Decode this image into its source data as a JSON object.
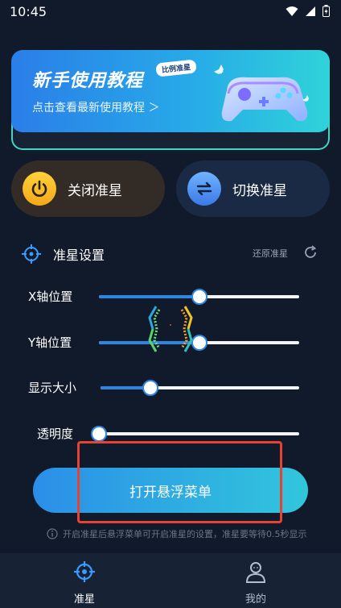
{
  "status_bar": {
    "time": "10:45"
  },
  "banner": {
    "title": "新手使用教程",
    "badge": "比例准星",
    "subtitle": "点击查看最新使用教程 ＞"
  },
  "actions": {
    "close_label": "关闭准星",
    "switch_label": "切换准星"
  },
  "settings": {
    "title": "准星设置",
    "reset_label": "还原准星",
    "sliders": [
      {
        "label": "X轴位置",
        "value": 0.5
      },
      {
        "label": "Y轴位置",
        "value": 0.5
      },
      {
        "label": "显示大小",
        "value": 0.25
      },
      {
        "label": "透明度",
        "value": 0.0
      }
    ]
  },
  "cta": {
    "label": "打开悬浮菜单"
  },
  "hint": {
    "text": "开启准星后悬浮菜单可开启准星的设置，准星要等待0.5秒显示"
  },
  "tabs": [
    {
      "label": "准星",
      "active": true
    },
    {
      "label": "我的",
      "active": false
    }
  ],
  "colors": {
    "accent": "#2e86e0",
    "highlight_box": "#e8412f"
  }
}
